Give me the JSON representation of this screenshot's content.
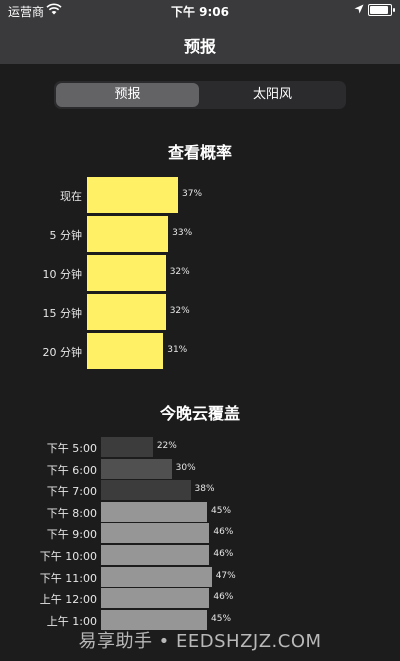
{
  "status": {
    "carrier": "运营商",
    "time": "下午 9:06",
    "battery_level": 0.9
  },
  "nav": {
    "title": "预报"
  },
  "tabs": [
    {
      "label": "预报",
      "selected": true
    },
    {
      "label": "太阳风",
      "selected": false
    }
  ],
  "chart_data": [
    {
      "type": "bar",
      "orientation": "horizontal",
      "title": "查看概率",
      "categories": [
        "现在",
        "5 分钟",
        "10 分钟",
        "15 分钟",
        "20 分钟"
      ],
      "values": [
        37,
        33,
        32,
        32,
        31
      ],
      "value_labels": [
        "37%",
        "33%",
        "32%",
        "32%",
        "31%"
      ],
      "unit": "%",
      "color": "#fff066"
    },
    {
      "type": "bar",
      "orientation": "horizontal",
      "title": "今晚云覆盖",
      "categories": [
        "下午 5:00",
        "下午 6:00",
        "下午 7:00",
        "下午 8:00",
        "下午 9:00",
        "下午 10:00",
        "下午 11:00",
        "上午 12:00",
        "上午 1:00"
      ],
      "values": [
        22,
        30,
        38,
        45,
        46,
        46,
        47,
        46,
        45
      ],
      "value_labels": [
        "22%",
        "30%",
        "38%",
        "45%",
        "46%",
        "46%",
        "47%",
        "46%",
        "45%"
      ],
      "unit": "%",
      "colors": [
        "#3c3c3c",
        "#505050",
        "#3c3c3c",
        "#969696",
        "#969696",
        "#969696",
        "#969696",
        "#969696",
        "#969696"
      ]
    }
  ],
  "watermark": "易享助手 • EEDSHZJZ.COM"
}
